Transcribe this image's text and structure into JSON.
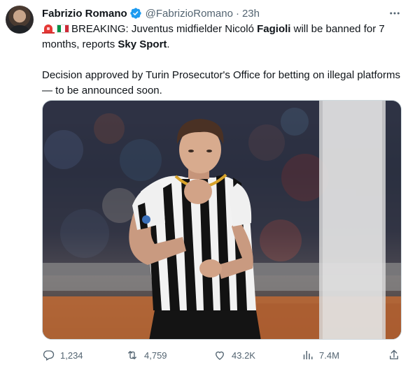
{
  "tweet": {
    "author_name": "Fabrizio Romano",
    "handle": "@FabrizioRomano",
    "separator": "·",
    "time": "23h",
    "line1_prefix": "BREAKING: Juventus midfielder Nicoló ",
    "line1_bold": "Fagioli",
    "line1_suffix": " will be banned for 7 months, reports ",
    "line1_source": "Sky Sport",
    "line1_end": ".",
    "line2": "Decision approved by Turin Prosecutor's Office for betting on illegal platforms — to be announced soon."
  },
  "actions": {
    "replies": "1,234",
    "reposts": "4,759",
    "likes": "43.2K",
    "views": "7.4M"
  },
  "colors": {
    "verified": "#1d9bf0",
    "secondary_text": "#536471",
    "jersey_black": "#111111",
    "jersey_white": "#f4f4f4"
  }
}
